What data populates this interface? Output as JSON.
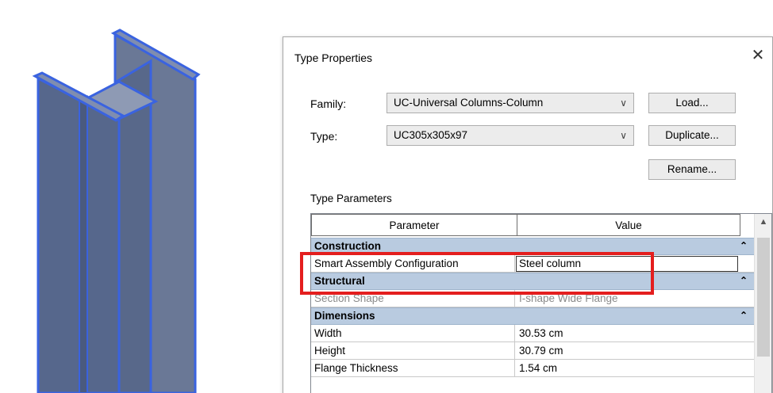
{
  "dialog": {
    "title": "Type Properties",
    "close_glyph": "✕"
  },
  "fields": {
    "family_label": "Family:",
    "family_value": "UC-Universal Columns-Column",
    "type_label": "Type:",
    "type_value": "UC305x305x97"
  },
  "buttons": {
    "load": "Load...",
    "duplicate": "Duplicate...",
    "rename": "Rename..."
  },
  "type_parameters": {
    "label": "Type Parameters",
    "columns": [
      "Parameter",
      "Value"
    ],
    "groups": [
      {
        "name": "Construction",
        "rows": [
          {
            "parameter": "Smart Assembly Configuration",
            "value": "Steel column",
            "editing": true
          }
        ]
      },
      {
        "name": "Structural",
        "rows": [
          {
            "parameter": "Section Shape",
            "value": "I-shape Wide Flange",
            "readonly": true
          }
        ]
      },
      {
        "name": "Dimensions",
        "rows": [
          {
            "parameter": "Width",
            "value": "30.53 cm"
          },
          {
            "parameter": "Height",
            "value": "30.79 cm"
          },
          {
            "parameter": "Flange Thickness",
            "value": "1.54 cm"
          }
        ]
      }
    ]
  },
  "icons": {
    "dropdown": "chevron-down-icon",
    "collapse": "double-chevron-up-icon",
    "scroll_up": "scroll-up-arrow-icon"
  },
  "colors": {
    "highlight": "#e41e1e",
    "group_row": "#b9cbe0",
    "beam_fill": "#5d6d8f",
    "beam_edge": "#3a63e0"
  }
}
